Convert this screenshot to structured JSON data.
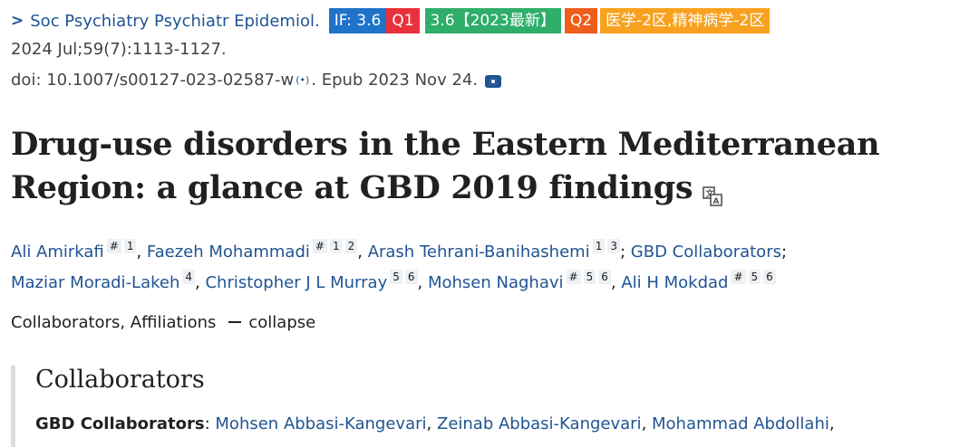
{
  "journal": {
    "name": "Soc Psychiatry Psychiatr Epidemiol.",
    "badges": {
      "if": "IF: 3.6",
      "q1": "Q1",
      "cas": "3.6【2023最新】",
      "q2": "Q2",
      "category": "医学-2区,精神病学-2区"
    }
  },
  "citation": {
    "line1": "2024 Jul;59(7):1113-1127.",
    "doi": "doi: 10.1007/s00127-023-02587-w",
    "epub": ". Epub 2023 Nov 24."
  },
  "title": {
    "line1": "Drug-use disorders in the Eastern Mediterranean",
    "line2": "Region: a glance at GBD 2019 findings"
  },
  "authors": [
    {
      "name": "Ali Amirkafi",
      "affs": [
        "#",
        "1"
      ]
    },
    {
      "name": "Faezeh Mohammadi",
      "affs": [
        "#",
        "1",
        "2"
      ]
    },
    {
      "name": "Arash Tehrani-Banihashemi",
      "affs": [
        "1",
        "3"
      ]
    },
    {
      "name": "GBD Collaborators",
      "affs": []
    },
    {
      "name": "Maziar Moradi-Lakeh",
      "affs": [
        "4"
      ]
    },
    {
      "name": "Christopher J L Murray",
      "affs": [
        "5",
        "6"
      ]
    },
    {
      "name": "Mohsen Naghavi",
      "affs": [
        "#",
        "5",
        "6"
      ]
    },
    {
      "name": "Ali H Mokdad",
      "affs": [
        "#",
        "5",
        "6"
      ]
    }
  ],
  "toggle": {
    "label": "Collaborators, Affiliations",
    "action": "collapse"
  },
  "collaborators": {
    "heading": "Collaborators",
    "group": "GBD Collaborators",
    "names": [
      "Mohsen Abbasi-Kangevari",
      "Zeinab Abbasi-Kangevari",
      "Mohammad Abdollahi"
    ]
  }
}
